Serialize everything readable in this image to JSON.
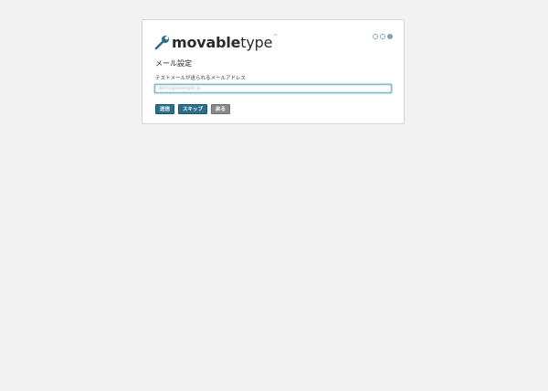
{
  "logo": {
    "movable": "movable",
    "type": "type",
    "tm": "™"
  },
  "steps": {
    "total": 3,
    "current": 3
  },
  "page": {
    "title": "メール設定"
  },
  "form": {
    "email_label": "テストメールが送られるメールアドレス",
    "email_value": "demo@example.jp"
  },
  "buttons": {
    "send": "送信",
    "skip": "スキップ",
    "back": "戻る"
  },
  "colors": {
    "accent": "#2b6f8c",
    "back_button": "#8a8a8a",
    "background": "#f2f2f2"
  }
}
